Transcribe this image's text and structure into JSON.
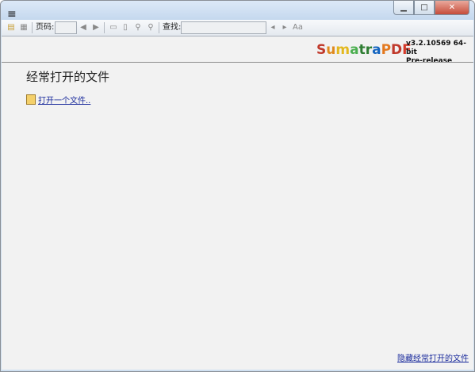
{
  "titlebar": {
    "menu_icon": "hamburger-menu-icon",
    "minimize": "▁",
    "maximize": "□",
    "close": "✕"
  },
  "toolbar": {
    "page_label": "页码:",
    "find_label": "查找:",
    "page_value": "",
    "find_value": ""
  },
  "brand": {
    "name_parts": [
      {
        "text": "S",
        "color": "#c0392b"
      },
      {
        "text": "u",
        "color": "#e08a1e"
      },
      {
        "text": "m",
        "color": "#e3b81f"
      },
      {
        "text": "a",
        "color": "#4caf50"
      },
      {
        "text": "t",
        "color": "#2e7d32"
      },
      {
        "text": "r",
        "color": "#2e7d32"
      },
      {
        "text": "a",
        "color": "#1565c0"
      },
      {
        "text": "P",
        "color": "#e3791f"
      },
      {
        "text": "D",
        "color": "#c0392b"
      },
      {
        "text": "F",
        "color": "#d43a2a"
      }
    ],
    "version_line1": "v3.2.10569 64-bit",
    "version_line2": "Pre-release"
  },
  "main": {
    "heading": "经常打开的文件",
    "open_link": "打开一个文件..",
    "hide_link": "隐藏经常打开的文件"
  }
}
